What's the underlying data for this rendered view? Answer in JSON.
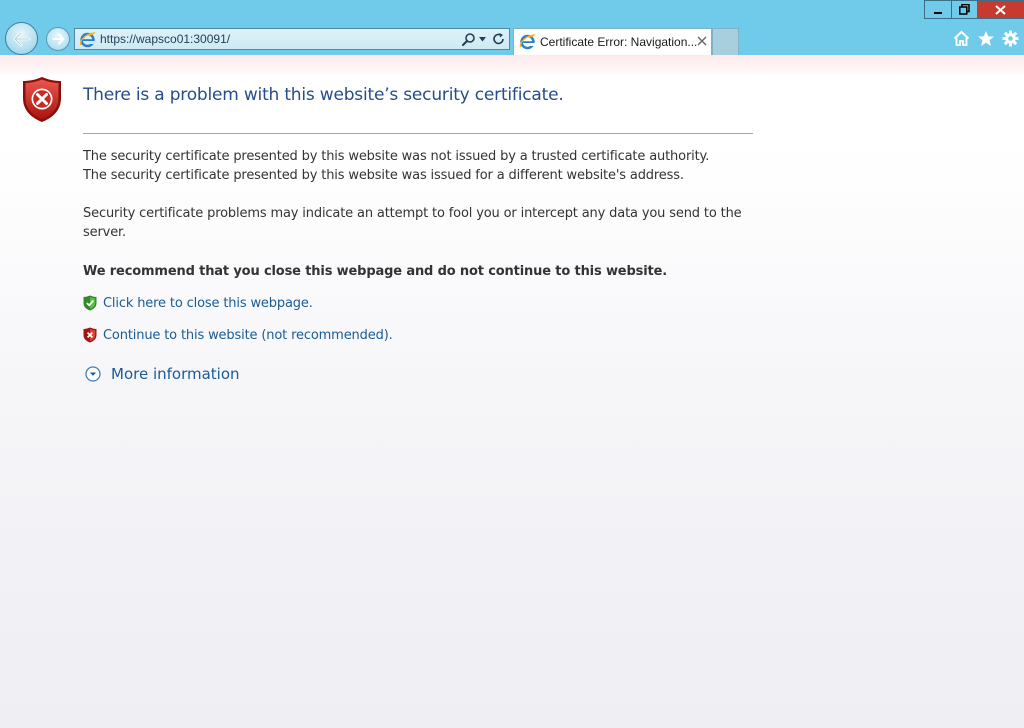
{
  "browser": {
    "address_url": "https://wapsco01:30091/",
    "tab_title": "Certificate Error: Navigation...",
    "colors": {
      "chrome_bg": "#6fcbe9",
      "close_button": "#c73a2f"
    },
    "toolbar_icons": [
      "home-icon",
      "favorites-icon",
      "tools-icon"
    ]
  },
  "page": {
    "title": "There is a problem with this website’s security certificate.",
    "line1": "The security certificate presented by this website was not issued by a trusted certificate authority.",
    "line2": "The security certificate presented by this website was issued for a different website's address.",
    "para2": "Security certificate problems may indicate an attempt to fool you or intercept any data you send to the server.",
    "recommendation": "We recommend that you close this webpage and do not continue to this website.",
    "close_link": "Click here to close this webpage.",
    "continue_link": "Continue to this website (not recommended).",
    "more_info": "More information",
    "colors": {
      "title": "#264c89",
      "link": "#1a5b96",
      "text": "#333333"
    }
  }
}
